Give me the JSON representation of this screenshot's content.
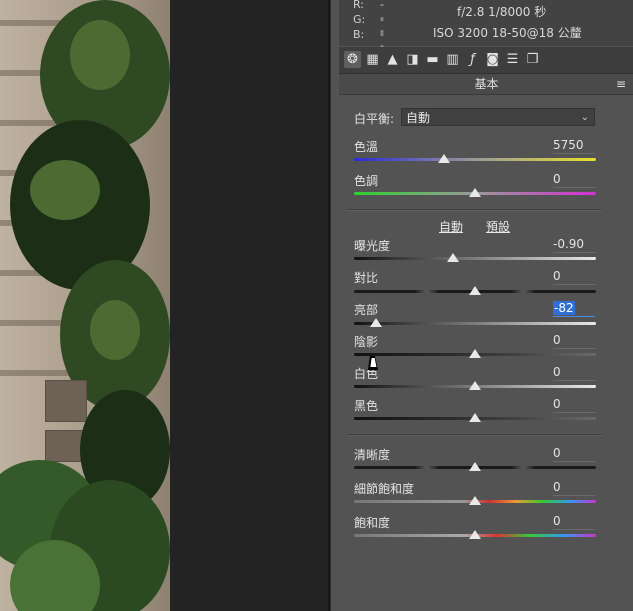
{
  "info": {
    "rgb": [
      {
        "label": "R:",
        "value": "---"
      },
      {
        "label": "G:",
        "value": "---"
      },
      {
        "label": "B:",
        "value": "---"
      }
    ],
    "exif_line1": "f/2.8   1/8000 秒",
    "exif_line2": "ISO 3200   18-50@18 公釐"
  },
  "toolbar": {
    "icons": [
      "aperture-icon",
      "grid-icon",
      "mountain-icon",
      "split-icon",
      "halves-icon",
      "lens-icon",
      "fx-icon",
      "camera-icon",
      "sliders-icon",
      "presets-icon"
    ]
  },
  "section": {
    "title": "基本",
    "menu_glyph": "≡"
  },
  "white_balance": {
    "label": "白平衡:",
    "value": "自動"
  },
  "temperature": {
    "label": "色溫",
    "value": "5750",
    "level": 0.37
  },
  "tint": {
    "label": "色調",
    "value": "0",
    "level": 0.5
  },
  "tone_links": {
    "auto": "自動",
    "default": "預設"
  },
  "exposure": {
    "label": "曝光度",
    "value": "-0.90",
    "level": 0.41
  },
  "contrast": {
    "label": "對比",
    "value": "0",
    "level": 0.5
  },
  "highlights": {
    "label": "亮部",
    "value": "-82",
    "level": 0.09
  },
  "shadows": {
    "label": "陰影",
    "value": "0",
    "level": 0.5
  },
  "whites": {
    "label": "白色",
    "value": "0",
    "level": 0.5
  },
  "blacks": {
    "label": "黑色",
    "value": "0",
    "level": 0.5
  },
  "clarity": {
    "label": "清晰度",
    "value": "0",
    "level": 0.5
  },
  "vibrance": {
    "label": "細節飽和度",
    "value": "0",
    "level": 0.5
  },
  "saturation": {
    "label": "飽和度",
    "value": "0",
    "level": 0.5
  }
}
